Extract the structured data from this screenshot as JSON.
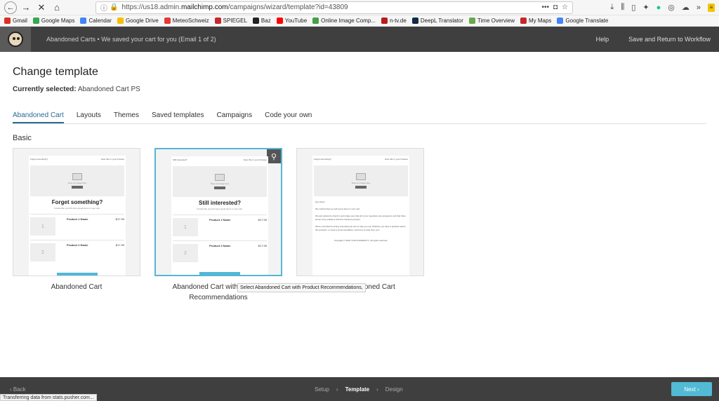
{
  "browser": {
    "url_prefix": "https://us18.admin.",
    "url_domain": "mailchimp.com",
    "url_suffix": "/campaigns/wizard/template?id=43809",
    "menu_dots": "•••"
  },
  "bookmarks": [
    {
      "label": "Gmail",
      "color": "#d93025"
    },
    {
      "label": "Google Maps",
      "color": "#34a853"
    },
    {
      "label": "Calendar",
      "color": "#4285f4"
    },
    {
      "label": "Google Drive",
      "color": "#fbbc04"
    },
    {
      "label": "MeteoSchweiz",
      "color": "#e53935"
    },
    {
      "label": "SPIEGEL",
      "color": "#c62828"
    },
    {
      "label": "Baz",
      "color": "#222222"
    },
    {
      "label": "YouTube",
      "color": "#ff0000"
    },
    {
      "label": "Online Image Comp...",
      "color": "#43a047"
    },
    {
      "label": "n-tv.de",
      "color": "#b71c1c"
    },
    {
      "label": "DeepL Translator",
      "color": "#0f2b46"
    },
    {
      "label": "Time Overview",
      "color": "#6aa84f"
    },
    {
      "label": "My Maps",
      "color": "#c62828"
    },
    {
      "label": "Google Translate",
      "color": "#4285f4"
    }
  ],
  "appbar": {
    "title": "Abandoned Carts • We saved your cart for you (Email 1 of 2)",
    "help": "Help",
    "save_return": "Save and Return to Workflow"
  },
  "page": {
    "title": "Change template",
    "current_label": "Currently selected:",
    "current_value": "Abandoned Cart PS",
    "section": "Basic"
  },
  "tabs": [
    "Abandoned Cart",
    "Layouts",
    "Themes",
    "Saved templates",
    "Campaigns",
    "Code your own"
  ],
  "cards": [
    {
      "label": "Abandoned Cart",
      "hdr_left": "Forgot something?",
      "hdr_right": "View this in your browser",
      "img_text": "Drop an image here",
      "heading": "Forget something?",
      "sub": "It looks like you left some great items in your cart.",
      "products": [
        {
          "name": "Product 1 Name",
          "price": "$17.99",
          "num": "1"
        },
        {
          "name": "Product 2 Name",
          "price": "$17.99",
          "num": "2"
        }
      ]
    },
    {
      "label": "Abandoned Cart with Product Recommendations",
      "hdr_left": "Still interested?",
      "hdr_right": "View this in your browser",
      "img_text": "Drop an image here",
      "heading": "Still interested?",
      "sub": "It looks like you left some great items in your cart.",
      "products": [
        {
          "name": "Product 1 Name",
          "price": "$17.99",
          "num": "1"
        },
        {
          "name": "Product 2 Name",
          "price": "$17.99",
          "num": "2"
        }
      ]
    },
    {
      "label": "Basic Abandoned Cart",
      "hdr_left": "Forgot something?",
      "hdr_right": "View this in your browser",
      "img_text": "Drop an image here",
      "body_lines": [
        "Hey there!",
        "We noticed that you left some items in your cart.",
        "We just wanted to check in and make sure that all of your questions are answered, and that there weren't any problems with the checkout process.",
        "We're committed to doing everything we can to help you out. Whether you have a question about the products, or need a recommendation, we'd love to hear from you!",
        "Copyright © 2018 *|LIST:COMPANY|*, All rights reserved."
      ]
    }
  ],
  "tooltip": "Select Abandoned Cart with Product Recommendations,",
  "footer": {
    "back": "‹  Back",
    "steps": [
      "Setup",
      "Template",
      "Design"
    ],
    "next": "Next  ›"
  },
  "status": "Transferring data from stats.pusher.com..."
}
